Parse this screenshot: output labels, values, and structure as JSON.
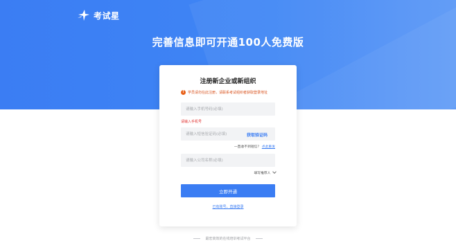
{
  "brand": {
    "name": "考试星",
    "logo_icon": "star-logo-icon",
    "colors": {
      "primary": "#3b7df3",
      "warning": "#e8621b",
      "error": "#e0302e"
    }
  },
  "hero": {
    "title": "完善信息即可开通100人免费版"
  },
  "form": {
    "title": "注册新企业或新组织",
    "notice": "学员请勿在此注册，请联系考试组织者获取登录地址",
    "phone_placeholder": "请输入手机号码(必填)",
    "phone_error": "请输入手机号",
    "code_placeholder": "请输入短信验证码(必填)",
    "get_code_label": "获取验证码",
    "resend_prompt": "一直收不到短信？",
    "resend_link": "点此重发",
    "company_placeholder": "请输入公司名称(必填)",
    "referrer_label": "填写推荐人",
    "submit_label": "立即开通",
    "login_link": "已有账号，直接登录"
  },
  "footer": {
    "tagline": "最宏高效的在线培训考试平台"
  }
}
